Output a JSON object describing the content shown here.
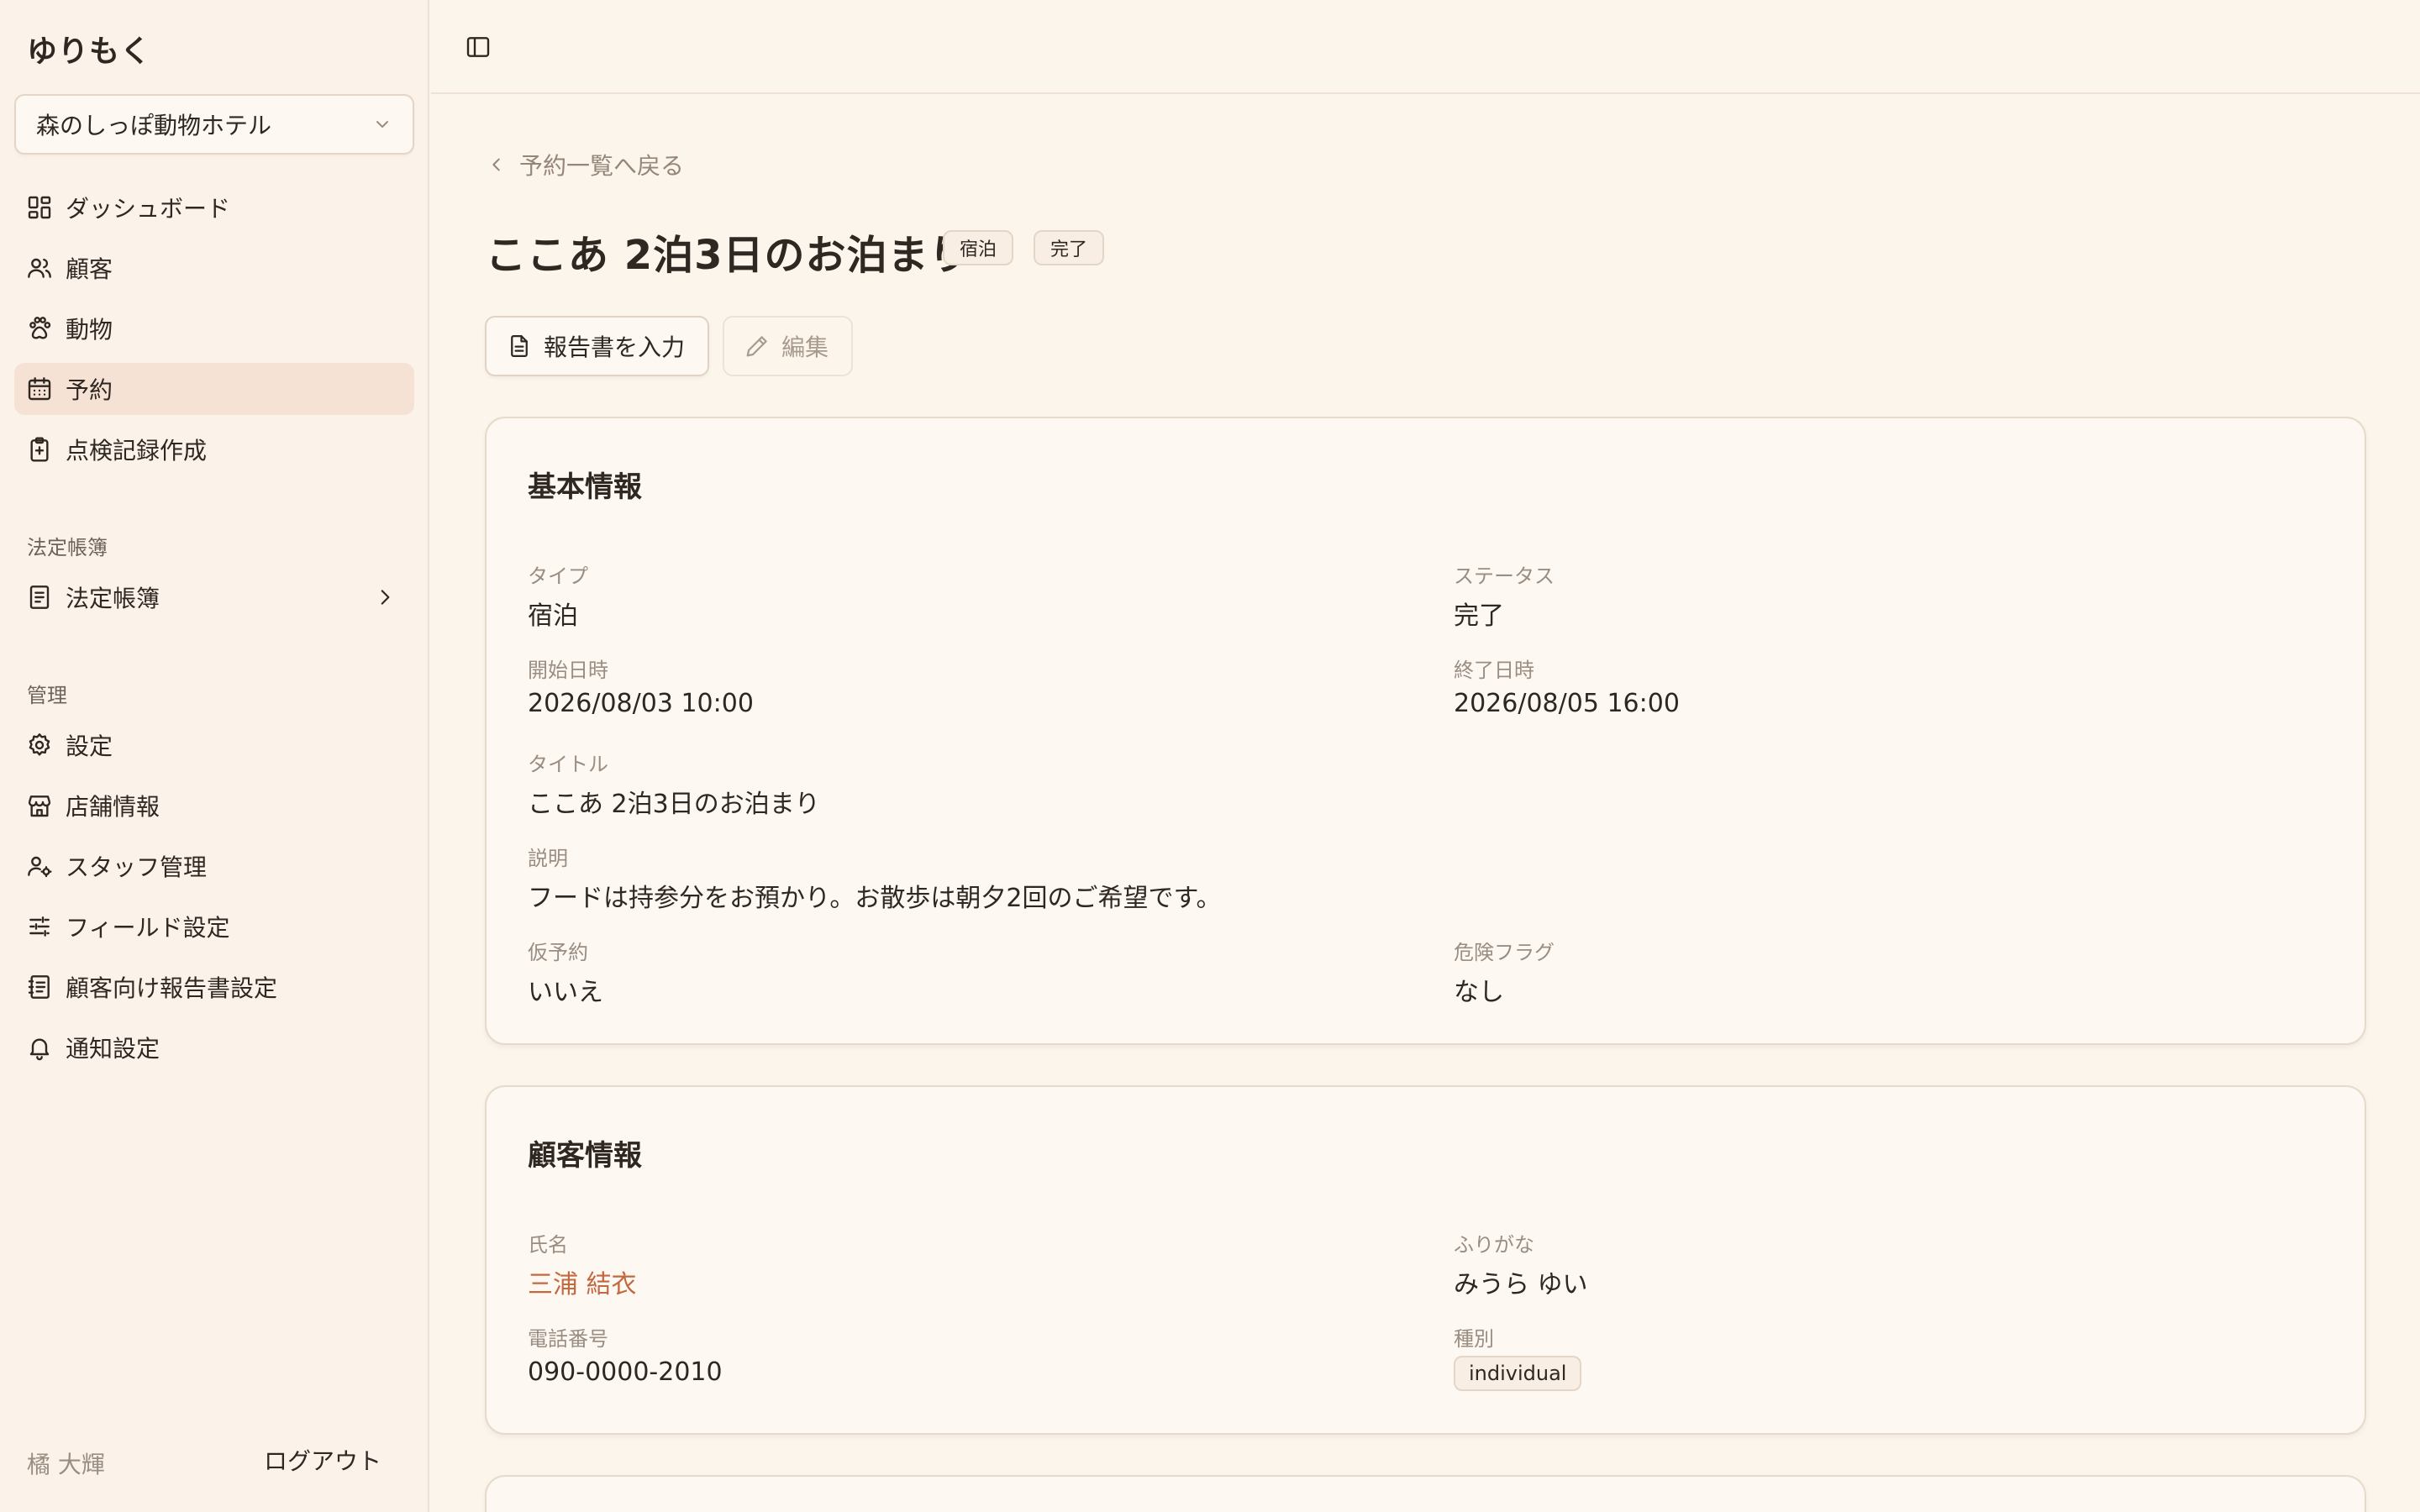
{
  "app": {
    "brand": "ゆりもく"
  },
  "store_selector": {
    "value": "森のしっぽ動物ホテル"
  },
  "sidebar": {
    "items": [
      {
        "label": "ダッシュボード",
        "icon": "dashboard-icon"
      },
      {
        "label": "顧客",
        "icon": "users-icon"
      },
      {
        "label": "動物",
        "icon": "paw-icon"
      },
      {
        "label": "予約",
        "icon": "calendar-icon",
        "active": true
      },
      {
        "label": "点検記録作成",
        "icon": "clipboard-plus-icon"
      }
    ],
    "section_legal": "法定帳簿",
    "legal_item": {
      "label": "法定帳簿",
      "icon": "book-icon"
    },
    "section_admin": "管理",
    "admin_items": [
      {
        "label": "設定",
        "icon": "gear-icon"
      },
      {
        "label": "店舗情報",
        "icon": "store-icon"
      },
      {
        "label": "スタッフ管理",
        "icon": "user-gear-icon"
      },
      {
        "label": "フィールド設定",
        "icon": "sliders-icon"
      },
      {
        "label": "顧客向け報告書設定",
        "icon": "report-icon"
      },
      {
        "label": "通知設定",
        "icon": "bell-icon"
      }
    ],
    "user_name": "橘 大輝",
    "logout_label": "ログアウト"
  },
  "header": {
    "back_link": "予約一覧へ戻る",
    "title": "ここあ 2泊3日のお泊まり",
    "badges": [
      "宿泊",
      "完了"
    ]
  },
  "actions": {
    "report_button": "報告書を入力",
    "edit_button": "編集"
  },
  "basic_info": {
    "title": "基本情報",
    "type_label": "タイプ",
    "type_value": "宿泊",
    "status_label": "ステータス",
    "status_value": "完了",
    "start_label": "開始日時",
    "start_value": "2026/08/03 10:00",
    "end_label": "終了日時",
    "end_value": "2026/08/05 16:00",
    "title_label": "タイトル",
    "title_value": "ここあ 2泊3日のお泊まり",
    "desc_label": "説明",
    "desc_value": "フードは持参分をお預かり。お散歩は朝夕2回のご希望です。",
    "tentative_label": "仮予約",
    "tentative_value": "いいえ",
    "danger_label": "危険フラグ",
    "danger_value": "なし"
  },
  "customer_info": {
    "title": "顧客情報",
    "name_label": "氏名",
    "name_value": "三浦 結衣",
    "kana_label": "ふりがな",
    "kana_value": "みうら ゆい",
    "phone_label": "電話番号",
    "phone_value": "090-0000-2010",
    "kind_label": "種別",
    "kind_value": "individual"
  },
  "colors": {
    "background": "#fcf5ec",
    "active_nav": "#f5e2d4",
    "link_accent": "#c4683f",
    "text": "#2f2722",
    "muted": "#9a8d82"
  }
}
